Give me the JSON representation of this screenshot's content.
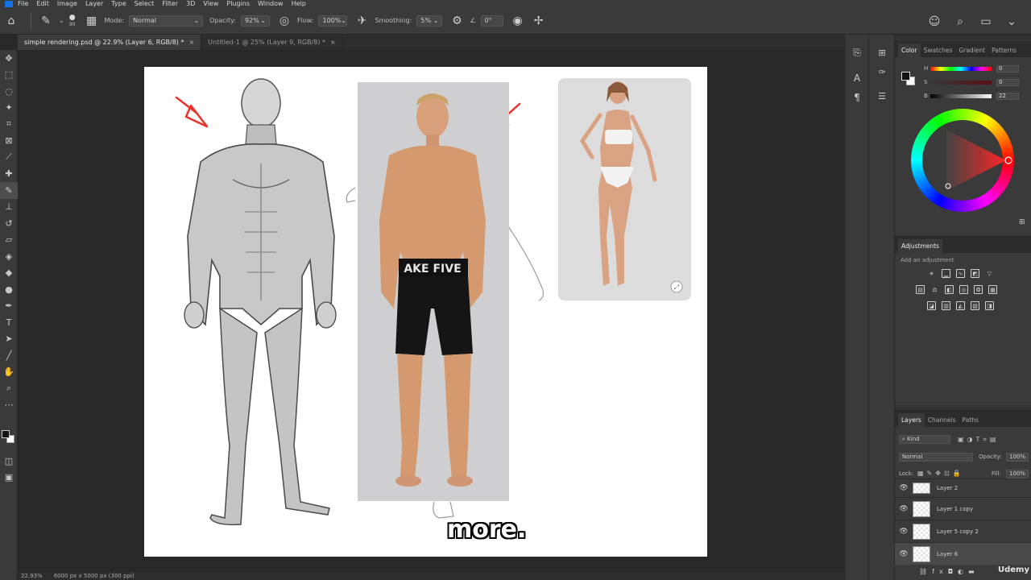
{
  "menu": [
    "File",
    "Edit",
    "Image",
    "Layer",
    "Type",
    "Select",
    "Filter",
    "3D",
    "View",
    "Plugins",
    "Window",
    "Help"
  ],
  "options": {
    "brush_size": "90",
    "mode_label": "Mode:",
    "mode_value": "Normal",
    "opacity_label": "Opacity:",
    "opacity_value": "92%",
    "flow_label": "Flow:",
    "flow_value": "100%",
    "smoothing_label": "Smoothing:",
    "smoothing_value": "5%",
    "angle_value": "0°"
  },
  "tabs": [
    {
      "label": "simple rendering.psd @ 22.9% (Layer 6, RGB/8) *",
      "close": "×"
    },
    {
      "label": "Untitled-1 @ 25% (Layer 9, RGB/8) *",
      "close": "×"
    }
  ],
  "status": {
    "zoom": "22.93%",
    "doc_size": "6000 px x 5000 px (300 ppi)"
  },
  "caption": "more.",
  "color_panel": {
    "tabs": [
      "Color",
      "Swatches",
      "Gradient",
      "Patterns"
    ],
    "h_label": "H",
    "h_value": "0",
    "s_label": "S",
    "s_value": "0",
    "b_label": "B",
    "b_value": "22"
  },
  "adjustments": {
    "title": "Adjustments",
    "hint": "Add an adjustment"
  },
  "layers_panel": {
    "tabs": [
      "Layers",
      "Channels",
      "Paths"
    ],
    "kind_label": "Kind",
    "blend_mode": "Normal",
    "opacity_label": "Opacity:",
    "opacity_value": "100%",
    "lock_label": "Lock:",
    "fill_label": "Fill:",
    "fill_value": "100%",
    "layers": [
      {
        "name": "Layer 2"
      },
      {
        "name": "Layer 1 copy"
      },
      {
        "name": "Layer 5 copy 2"
      },
      {
        "name": "Layer 6"
      }
    ]
  },
  "colors": {
    "accent": "#1473e6",
    "panel": "#3a3a3a",
    "canvas_bg": "#282828",
    "arrow_red": "#e8332b"
  },
  "watermark": "Udemy"
}
